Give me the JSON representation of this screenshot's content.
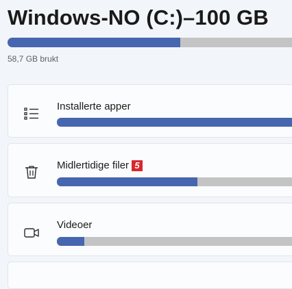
{
  "drive": {
    "title": "Windows-NO (C:)–100 GB",
    "used_label": "58,7 GB brukt",
    "used_fraction": 0.587
  },
  "categories": [
    {
      "label": "Installerte apper",
      "icon": "list-icon",
      "fill_fraction": 1.0
    },
    {
      "label": "Midlertidige filer",
      "icon": "trash-icon",
      "fill_fraction": 0.57,
      "badge": "5"
    },
    {
      "label": "Videoer",
      "icon": "video-camera-icon",
      "fill_fraction": 0.11
    },
    {
      "label": "",
      "icon": "",
      "fill_fraction": 0
    }
  ],
  "colors": {
    "bar_fill": "#4766b0",
    "bar_track": "#c4c4c4",
    "badge": "#d8262c",
    "background": "#f2f5f9",
    "card": "#fbfcfd"
  }
}
